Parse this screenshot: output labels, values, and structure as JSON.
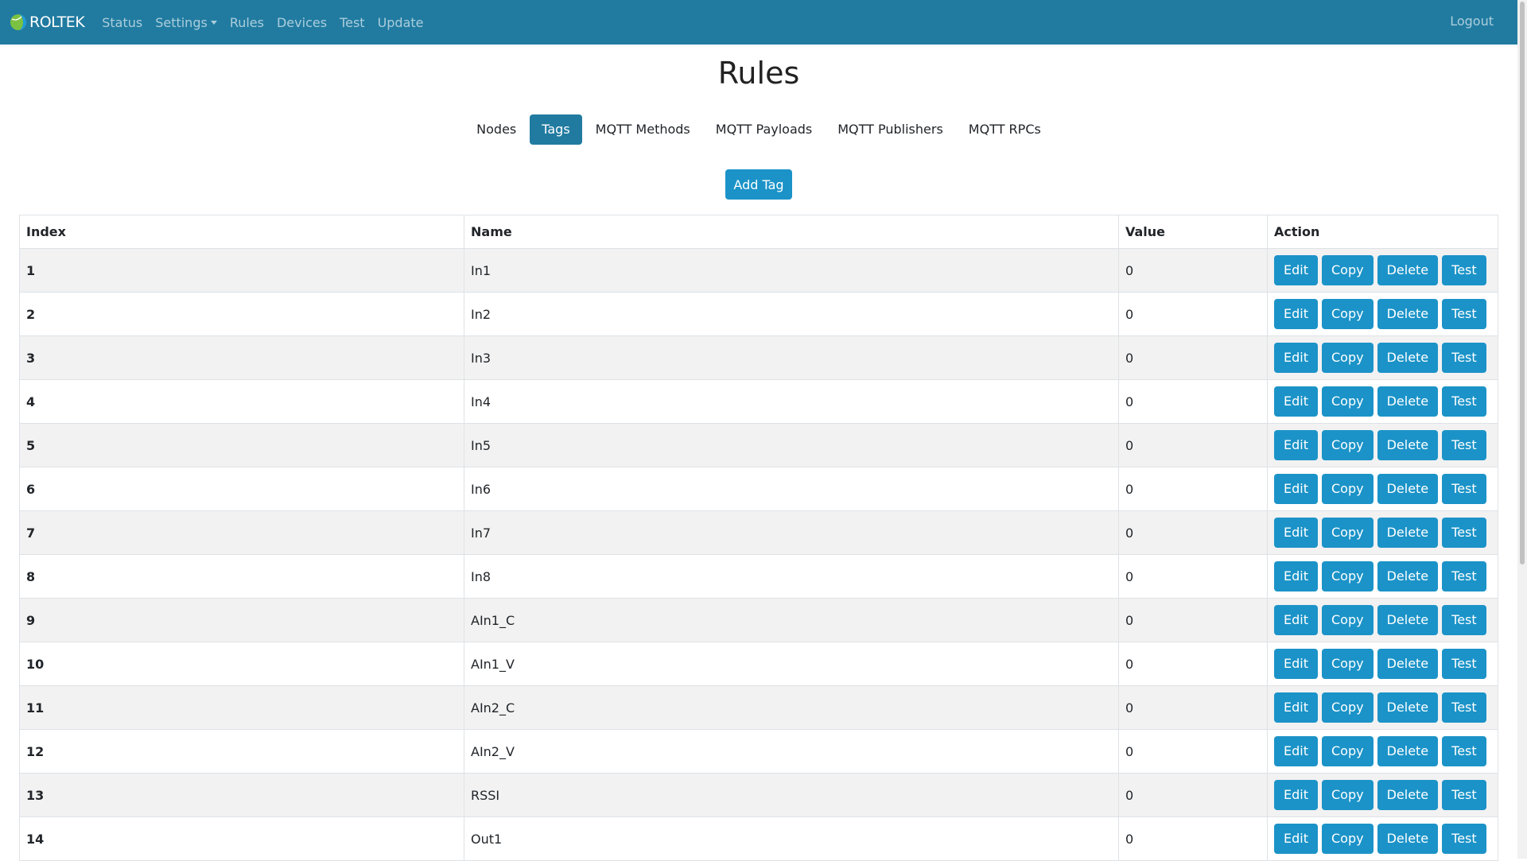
{
  "navbar": {
    "brand": "ROLTEK",
    "items": [
      "Status",
      "Settings",
      "Rules",
      "Devices",
      "Test",
      "Update"
    ],
    "logout": "Logout"
  },
  "page": {
    "title": "Rules"
  },
  "tabs": [
    {
      "label": "Nodes",
      "active": false
    },
    {
      "label": "Tags",
      "active": true
    },
    {
      "label": "MQTT Methods",
      "active": false
    },
    {
      "label": "MQTT Payloads",
      "active": false
    },
    {
      "label": "MQTT Publishers",
      "active": false
    },
    {
      "label": "MQTT RPCs",
      "active": false
    }
  ],
  "add_button": "Add Tag",
  "table": {
    "headers": [
      "Index",
      "Name",
      "Value",
      "Action"
    ],
    "actions": [
      "Edit",
      "Copy",
      "Delete",
      "Test"
    ],
    "rows": [
      {
        "index": "1",
        "name": "In1",
        "value": "0"
      },
      {
        "index": "2",
        "name": "In2",
        "value": "0"
      },
      {
        "index": "3",
        "name": "In3",
        "value": "0"
      },
      {
        "index": "4",
        "name": "In4",
        "value": "0"
      },
      {
        "index": "5",
        "name": "In5",
        "value": "0"
      },
      {
        "index": "6",
        "name": "In6",
        "value": "0"
      },
      {
        "index": "7",
        "name": "In7",
        "value": "0"
      },
      {
        "index": "8",
        "name": "In8",
        "value": "0"
      },
      {
        "index": "9",
        "name": "AIn1_C",
        "value": "0"
      },
      {
        "index": "10",
        "name": "AIn1_V",
        "value": "0"
      },
      {
        "index": "11",
        "name": "AIn2_C",
        "value": "0"
      },
      {
        "index": "12",
        "name": "AIn2_V",
        "value": "0"
      },
      {
        "index": "13",
        "name": "RSSI",
        "value": "0"
      },
      {
        "index": "14",
        "name": "Out1",
        "value": "0"
      }
    ]
  },
  "colors": {
    "navbar": "#217ba1",
    "button": "#1b93c8",
    "stripe": "#f2f2f2"
  }
}
